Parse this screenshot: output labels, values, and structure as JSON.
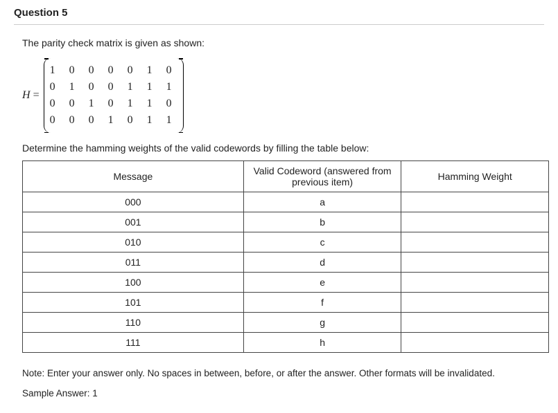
{
  "question": {
    "title": "Question 5",
    "intro": "The parity check matrix is given as shown:",
    "matrix_label": "H",
    "equals": "=",
    "matrix_rows": [
      "1 0 0 0 0 1 0",
      "0 1 0 0 1 1 1",
      "0 0 1 0 1 1 0",
      "0 0 0 1 0 1 1"
    ],
    "instruction": "Determine the hamming weights of the valid codewords by filling the table below:",
    "table": {
      "headers": {
        "message": "Message",
        "codeword": "Valid Codeword (answered from previous item)",
        "weight": "Hamming Weight"
      },
      "rows": [
        {
          "message": "000",
          "codeword": "a",
          "weight": ""
        },
        {
          "message": "001",
          "codeword": "b",
          "weight": ""
        },
        {
          "message": "010",
          "codeword": "c",
          "weight": ""
        },
        {
          "message": "011",
          "codeword": "d",
          "weight": ""
        },
        {
          "message": "100",
          "codeword": "e",
          "weight": ""
        },
        {
          "message": "101",
          "codeword": "f",
          "weight": ""
        },
        {
          "message": "110",
          "codeword": "g",
          "weight": ""
        },
        {
          "message": "111",
          "codeword": "h",
          "weight": ""
        }
      ]
    },
    "note": "Note: Enter your answer only. No spaces in between, before, or after the answer. Other formats will be invalidated.",
    "sample": "Sample Answer: 1"
  }
}
